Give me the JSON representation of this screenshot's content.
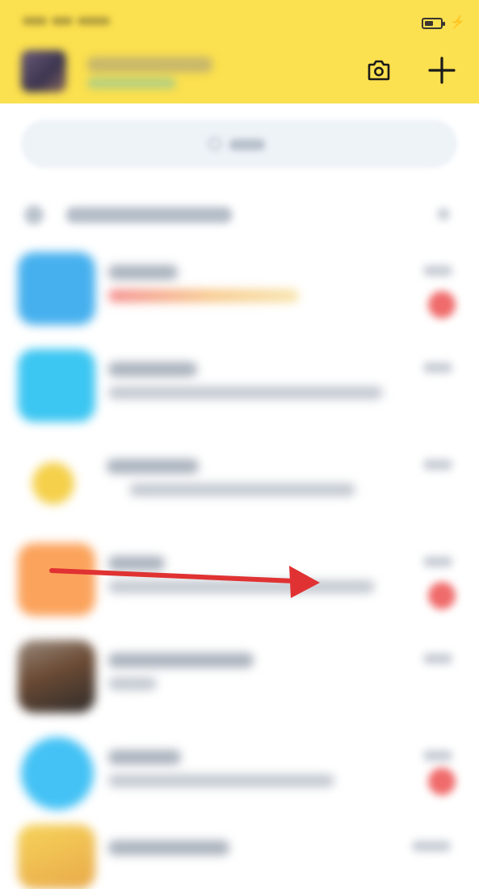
{
  "status_bar": {
    "time": "",
    "battery_icon": "battery-icon",
    "charging_icon": "charging-bolt-icon",
    "charging_glyph": "⚡"
  },
  "header": {
    "background": "#fbe04f",
    "camera_icon": "camera-icon",
    "add_icon": "plus-icon"
  },
  "search": {
    "placeholder": "",
    "icon": "search-icon"
  },
  "section": {
    "icon": "device-icon",
    "title": ""
  },
  "conversations": [
    {
      "icon_color": "#46b0ee",
      "unread": true,
      "highlight_line": true
    },
    {
      "icon_color": "#3cc6f2",
      "unread": false,
      "highlight_line": false
    },
    {
      "icon_color": "#f5d04a",
      "unread": false,
      "highlight_line": false
    },
    {
      "icon_color": "#fba35c",
      "unread": true,
      "highlight_line": false
    },
    {
      "icon_color": "#5a4a3c",
      "unread": false,
      "highlight_line": false
    },
    {
      "icon_color": "#44c2f5",
      "unread": true,
      "highlight_line": false
    },
    {
      "icon_color": "#f3c94c",
      "unread": false,
      "highlight_line": false
    }
  ],
  "annotation": {
    "type": "arrow",
    "color": "#e03232",
    "direction": "right"
  }
}
